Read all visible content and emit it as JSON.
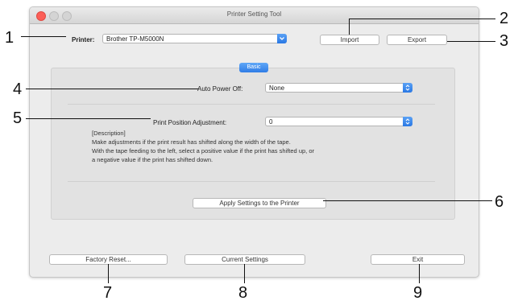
{
  "window": {
    "title": "Printer Setting Tool"
  },
  "printer": {
    "label": "Printer:",
    "value": "Brother TP-M5000N"
  },
  "buttons": {
    "import": "Import",
    "export": "Export",
    "apply": "Apply Settings to the Printer",
    "factory_reset": "Factory Reset...",
    "current_settings": "Current Settings",
    "exit": "Exit"
  },
  "tab": {
    "label": "Basic"
  },
  "auto_power_off": {
    "label": "Auto Power Off:",
    "value": "None"
  },
  "print_position": {
    "label": "Print Position Adjustment:",
    "value": "0"
  },
  "description": {
    "heading": "[Description]",
    "line1": "Make adjustments if the print result has shifted along the width of the tape.",
    "line2": "With the tape feeding to the left, select a positive value if the print has shifted up, or",
    "line3": "a negative value if the print has shifted down."
  },
  "callouts": [
    "1",
    "2",
    "3",
    "4",
    "5",
    "6",
    "7",
    "8",
    "9"
  ],
  "colors": {
    "accent": "#2f7ce6",
    "close": "#fc5f57"
  }
}
